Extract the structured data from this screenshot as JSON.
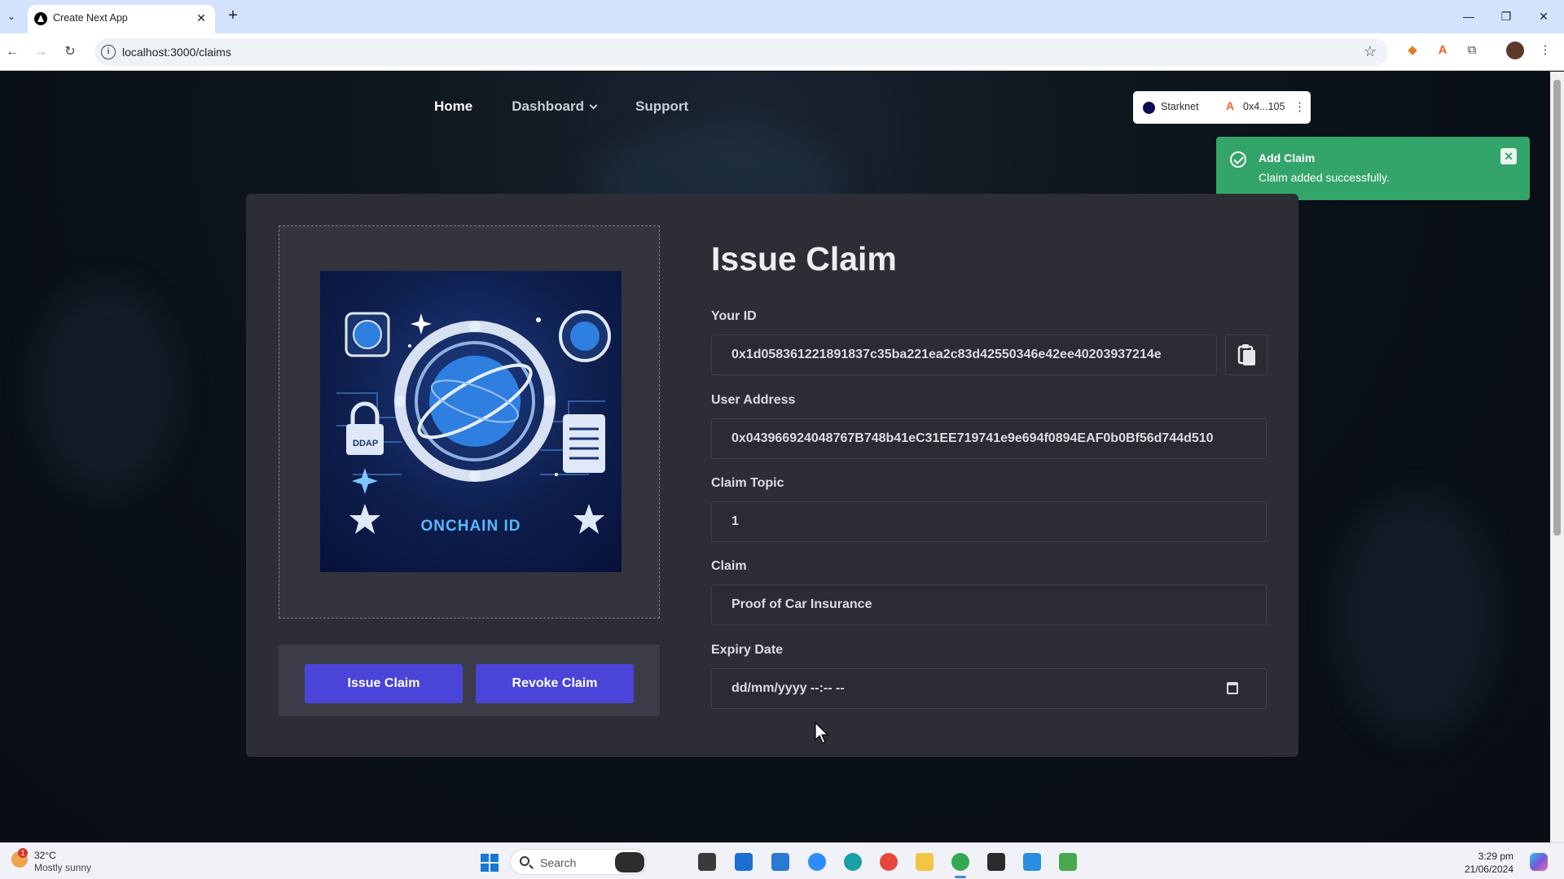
{
  "browser": {
    "tab_title": "Create Next App",
    "url": "localhost:3000/claims"
  },
  "nav": {
    "home": "Home",
    "dashboard": "Dashboard",
    "support": "Support"
  },
  "wallet": {
    "network": "Starknet",
    "address": "0x4...105"
  },
  "toast": {
    "title": "Add Claim",
    "message": "Claim added successfully."
  },
  "logo": {
    "badge": "DDAP",
    "text": "ONCHAIN ID"
  },
  "buttons": {
    "issue": "Issue Claim",
    "revoke": "Revoke Claim"
  },
  "form": {
    "title": "Issue Claim",
    "your_id_label": "Your ID",
    "your_id_value": "0x1d058361221891837c35ba221ea2c83d42550346e42ee40203937214e",
    "user_address_label": "User Address",
    "user_address_value": "0x043966924048767B748b41eC31EE719741e9e694f0894EAF0b0Bf56d744d510",
    "claim_topic_label": "Claim Topic",
    "claim_topic_value": "1",
    "claim_label": "Claim",
    "claim_value": "Proof of Car Insurance",
    "expiry_label": "Expiry Date",
    "expiry_value": "dd/mm/yyyy --:-- --"
  },
  "taskbar": {
    "temperature": "32°C",
    "weather": "Mostly sunny",
    "weather_alert_count": "1",
    "search_placeholder": "Search",
    "time": "3:29 pm",
    "date": "21/06/2024"
  },
  "colors": {
    "toast_green": "#34a56a",
    "button_purple": "#4a44d9",
    "card_bg": "#2c2d35"
  }
}
